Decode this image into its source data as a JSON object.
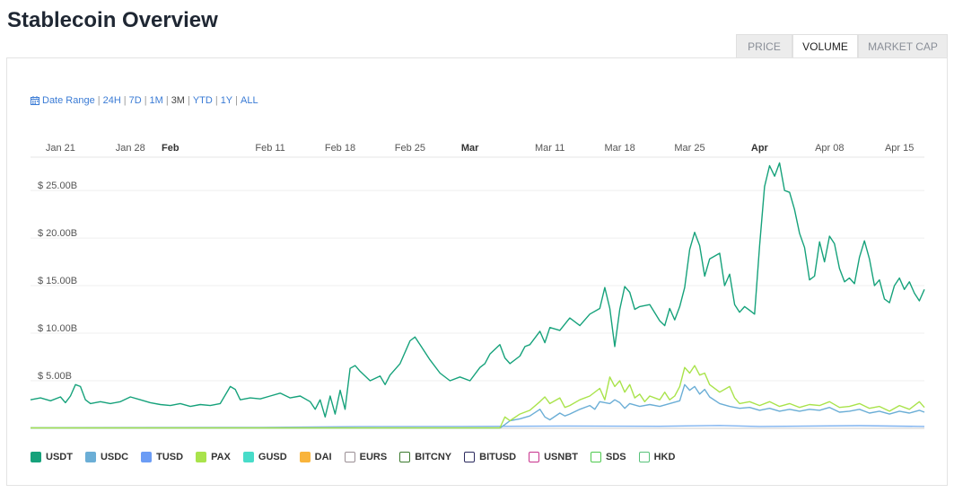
{
  "page": {
    "title": "Stablecoin Overview"
  },
  "tabs": [
    {
      "label": "PRICE",
      "active": false
    },
    {
      "label": "VOLUME",
      "active": true
    },
    {
      "label": "MARKET CAP",
      "active": false
    }
  ],
  "range": {
    "label": "Date Range",
    "options": [
      {
        "label": "24H",
        "active": false
      },
      {
        "label": "7D",
        "active": false
      },
      {
        "label": "1M",
        "active": false
      },
      {
        "label": "3M",
        "active": true
      },
      {
        "label": "YTD",
        "active": false
      },
      {
        "label": "1Y",
        "active": false
      },
      {
        "label": "ALL",
        "active": false
      }
    ]
  },
  "chart_data": {
    "type": "line",
    "x_ticks": [
      {
        "label": "Jan 21",
        "day": 0,
        "bold": false
      },
      {
        "label": "Jan 28",
        "day": 7,
        "bold": false
      },
      {
        "label": "Feb",
        "day": 11,
        "bold": true
      },
      {
        "label": "Feb 11",
        "day": 21,
        "bold": false
      },
      {
        "label": "Feb 18",
        "day": 28,
        "bold": false
      },
      {
        "label": "Feb 25",
        "day": 35,
        "bold": false
      },
      {
        "label": "Mar",
        "day": 41,
        "bold": true
      },
      {
        "label": "Mar 11",
        "day": 49,
        "bold": false
      },
      {
        "label": "Mar 18",
        "day": 56,
        "bold": false
      },
      {
        "label": "Mar 25",
        "day": 63,
        "bold": false
      },
      {
        "label": "Apr",
        "day": 70,
        "bold": true
      },
      {
        "label": "Apr 08",
        "day": 77,
        "bold": false
      },
      {
        "label": "Apr 15",
        "day": 84,
        "bold": false
      }
    ],
    "xlim": [
      -3,
      86.5
    ],
    "y_ticks": [
      {
        "label": "$ 5.00B",
        "value": 5
      },
      {
        "label": "$ 10.00B",
        "value": 10
      },
      {
        "label": "$ 15.00B",
        "value": 15
      },
      {
        "label": "$ 20.00B",
        "value": 20
      },
      {
        "label": "$ 25.00B",
        "value": 25
      }
    ],
    "ylim": [
      0,
      28.5
    ],
    "grid": true,
    "series": [
      {
        "name": "USDT",
        "color": "#16a27b",
        "points": [
          [
            -3,
            3.0
          ],
          [
            -2,
            3.2
          ],
          [
            -1,
            2.9
          ],
          [
            0,
            3.3
          ],
          [
            0.5,
            2.7
          ],
          [
            1,
            3.4
          ],
          [
            1.5,
            4.6
          ],
          [
            2,
            4.4
          ],
          [
            2.5,
            3.0
          ],
          [
            3,
            2.6
          ],
          [
            4,
            2.8
          ],
          [
            5,
            2.6
          ],
          [
            6,
            2.8
          ],
          [
            7,
            3.3
          ],
          [
            8,
            3.0
          ],
          [
            9,
            2.7
          ],
          [
            10,
            2.5
          ],
          [
            11,
            2.4
          ],
          [
            12,
            2.6
          ],
          [
            13,
            2.3
          ],
          [
            14,
            2.5
          ],
          [
            15,
            2.4
          ],
          [
            16,
            2.6
          ],
          [
            17,
            4.4
          ],
          [
            17.5,
            4.1
          ],
          [
            18,
            3.0
          ],
          [
            19,
            3.2
          ],
          [
            20,
            3.1
          ],
          [
            21,
            3.4
          ],
          [
            22,
            3.7
          ],
          [
            23,
            3.2
          ],
          [
            24,
            3.4
          ],
          [
            25,
            2.8
          ],
          [
            25.5,
            2.0
          ],
          [
            26,
            3.0
          ],
          [
            26.5,
            1.2
          ],
          [
            27,
            3.4
          ],
          [
            27.5,
            1.5
          ],
          [
            28,
            4.0
          ],
          [
            28.5,
            2.0
          ],
          [
            29,
            6.3
          ],
          [
            29.5,
            6.6
          ],
          [
            30,
            6.0
          ],
          [
            31,
            5.0
          ],
          [
            32,
            5.5
          ],
          [
            32.5,
            4.6
          ],
          [
            33,
            5.6
          ],
          [
            34,
            6.8
          ],
          [
            35,
            9.2
          ],
          [
            35.5,
            9.6
          ],
          [
            36,
            8.8
          ],
          [
            37,
            7.2
          ],
          [
            38,
            5.8
          ],
          [
            39,
            5.0
          ],
          [
            40,
            5.4
          ],
          [
            41,
            5.0
          ],
          [
            42,
            6.4
          ],
          [
            42.5,
            6.8
          ],
          [
            43,
            7.8
          ],
          [
            44,
            8.8
          ],
          [
            44.5,
            7.4
          ],
          [
            45,
            6.8
          ],
          [
            46,
            7.6
          ],
          [
            46.5,
            8.6
          ],
          [
            47,
            8.8
          ],
          [
            48,
            10.2
          ],
          [
            48.5,
            9.0
          ],
          [
            49,
            10.6
          ],
          [
            50,
            10.3
          ],
          [
            51,
            11.6
          ],
          [
            52,
            10.8
          ],
          [
            53,
            12.0
          ],
          [
            54,
            12.6
          ],
          [
            54.5,
            14.8
          ],
          [
            55,
            12.6
          ],
          [
            55.5,
            8.6
          ],
          [
            56,
            12.5
          ],
          [
            56.5,
            14.9
          ],
          [
            57,
            14.3
          ],
          [
            57.5,
            12.5
          ],
          [
            58,
            12.8
          ],
          [
            59,
            13.0
          ],
          [
            60,
            11.3
          ],
          [
            60.5,
            10.8
          ],
          [
            61,
            12.6
          ],
          [
            61.5,
            11.4
          ],
          [
            62,
            12.8
          ],
          [
            62.5,
            14.8
          ],
          [
            63,
            18.8
          ],
          [
            63.5,
            20.6
          ],
          [
            64,
            19.2
          ],
          [
            64.5,
            16.0
          ],
          [
            65,
            17.8
          ],
          [
            66,
            18.4
          ],
          [
            66.5,
            15.0
          ],
          [
            67,
            16.2
          ],
          [
            67.5,
            13.0
          ],
          [
            68,
            12.2
          ],
          [
            68.5,
            12.8
          ],
          [
            69,
            12.4
          ],
          [
            69.5,
            12.0
          ],
          [
            70,
            19.2
          ],
          [
            70.5,
            25.4
          ],
          [
            71,
            27.6
          ],
          [
            71.5,
            26.5
          ],
          [
            72,
            27.9
          ],
          [
            72.5,
            25.0
          ],
          [
            73,
            24.8
          ],
          [
            73.5,
            23.0
          ],
          [
            74,
            20.5
          ],
          [
            74.5,
            19.0
          ],
          [
            75,
            15.6
          ],
          [
            75.5,
            16.0
          ],
          [
            76,
            19.6
          ],
          [
            76.5,
            17.5
          ],
          [
            77,
            20.2
          ],
          [
            77.5,
            19.4
          ],
          [
            78,
            16.8
          ],
          [
            78.5,
            15.4
          ],
          [
            79,
            15.8
          ],
          [
            79.5,
            15.2
          ],
          [
            80,
            18.0
          ],
          [
            80.5,
            19.7
          ],
          [
            81,
            17.8
          ],
          [
            81.5,
            15.0
          ],
          [
            82,
            15.6
          ],
          [
            82.5,
            13.6
          ],
          [
            83,
            13.2
          ],
          [
            83.5,
            15.0
          ],
          [
            84,
            15.8
          ],
          [
            84.5,
            14.6
          ],
          [
            85,
            15.4
          ],
          [
            85.5,
            14.2
          ],
          [
            86,
            13.4
          ],
          [
            86.5,
            14.6
          ]
        ]
      },
      {
        "name": "PAX",
        "color": "#a9e34b",
        "points": [
          [
            -3,
            0.05
          ],
          [
            44,
            0.05
          ],
          [
            44.5,
            1.2
          ],
          [
            45,
            0.8
          ],
          [
            46,
            1.5
          ],
          [
            47,
            1.9
          ],
          [
            48,
            2.8
          ],
          [
            48.5,
            3.3
          ],
          [
            49,
            2.6
          ],
          [
            50,
            3.2
          ],
          [
            50.5,
            2.2
          ],
          [
            51,
            2.4
          ],
          [
            52,
            3.0
          ],
          [
            53,
            3.4
          ],
          [
            54,
            4.2
          ],
          [
            54.5,
            3.0
          ],
          [
            55,
            5.4
          ],
          [
            55.5,
            4.4
          ],
          [
            56,
            5.0
          ],
          [
            56.5,
            3.8
          ],
          [
            57,
            4.6
          ],
          [
            57.5,
            3.2
          ],
          [
            58,
            3.6
          ],
          [
            58.5,
            2.8
          ],
          [
            59,
            3.4
          ],
          [
            60,
            3.0
          ],
          [
            60.5,
            3.8
          ],
          [
            61,
            3.0
          ],
          [
            61.5,
            3.4
          ],
          [
            62,
            4.4
          ],
          [
            62.5,
            6.4
          ],
          [
            63,
            5.8
          ],
          [
            63.5,
            6.6
          ],
          [
            64,
            5.6
          ],
          [
            64.5,
            5.8
          ],
          [
            65,
            4.6
          ],
          [
            66,
            3.8
          ],
          [
            67,
            4.4
          ],
          [
            67.5,
            3.2
          ],
          [
            68,
            2.6
          ],
          [
            69,
            2.8
          ],
          [
            70,
            2.4
          ],
          [
            71,
            2.8
          ],
          [
            72,
            2.3
          ],
          [
            73,
            2.6
          ],
          [
            74,
            2.2
          ],
          [
            75,
            2.5
          ],
          [
            76,
            2.4
          ],
          [
            77,
            2.8
          ],
          [
            78,
            2.2
          ],
          [
            79,
            2.3
          ],
          [
            80,
            2.6
          ],
          [
            81,
            2.1
          ],
          [
            82,
            2.3
          ],
          [
            83,
            1.8
          ],
          [
            84,
            2.4
          ],
          [
            85,
            2.0
          ],
          [
            86,
            2.8
          ],
          [
            86.5,
            2.2
          ]
        ]
      },
      {
        "name": "USDC",
        "color": "#6baed6",
        "points": [
          [
            -3,
            0.03
          ],
          [
            44,
            0.03
          ],
          [
            44.5,
            0.4
          ],
          [
            45,
            0.8
          ],
          [
            46,
            1.0
          ],
          [
            47,
            1.3
          ],
          [
            48,
            2.0
          ],
          [
            48.5,
            1.2
          ],
          [
            49,
            0.9
          ],
          [
            50,
            1.6
          ],
          [
            50.5,
            1.3
          ],
          [
            51,
            1.5
          ],
          [
            52,
            2.0
          ],
          [
            53,
            2.4
          ],
          [
            53.5,
            2.0
          ],
          [
            54,
            2.8
          ],
          [
            55,
            2.6
          ],
          [
            55.5,
            3.0
          ],
          [
            56,
            2.7
          ],
          [
            56.5,
            2.1
          ],
          [
            57,
            2.6
          ],
          [
            58,
            2.3
          ],
          [
            59,
            2.5
          ],
          [
            60,
            2.3
          ],
          [
            61,
            2.6
          ],
          [
            62,
            2.9
          ],
          [
            62.5,
            4.6
          ],
          [
            63,
            4.0
          ],
          [
            63.5,
            4.4
          ],
          [
            64,
            3.6
          ],
          [
            64.5,
            4.1
          ],
          [
            65,
            3.3
          ],
          [
            66,
            2.6
          ],
          [
            67,
            2.3
          ],
          [
            68,
            2.1
          ],
          [
            69,
            2.2
          ],
          [
            70,
            1.9
          ],
          [
            71,
            2.1
          ],
          [
            72,
            1.8
          ],
          [
            73,
            2.0
          ],
          [
            74,
            1.8
          ],
          [
            75,
            2.0
          ],
          [
            76,
            1.9
          ],
          [
            77,
            2.2
          ],
          [
            78,
            1.7
          ],
          [
            79,
            1.8
          ],
          [
            80,
            2.0
          ],
          [
            81,
            1.6
          ],
          [
            82,
            1.8
          ],
          [
            83,
            1.5
          ],
          [
            84,
            1.8
          ],
          [
            85,
            1.6
          ],
          [
            86,
            1.9
          ],
          [
            86.5,
            1.7
          ]
        ]
      },
      {
        "name": "TUSD",
        "color": "#7fb3f0",
        "points": [
          [
            -3,
            0.08
          ],
          [
            20,
            0.1
          ],
          [
            30,
            0.18
          ],
          [
            40,
            0.2
          ],
          [
            50,
            0.25
          ],
          [
            60,
            0.22
          ],
          [
            66,
            0.3
          ],
          [
            70,
            0.2
          ],
          [
            80,
            0.28
          ],
          [
            86.5,
            0.2
          ]
        ]
      }
    ]
  },
  "legend": [
    {
      "label": "USDT",
      "color": "#16a27b",
      "filled": true
    },
    {
      "label": "USDC",
      "color": "#6baed6",
      "filled": true
    },
    {
      "label": "TUSD",
      "color": "#6b9cf5",
      "filled": true
    },
    {
      "label": "PAX",
      "color": "#a9e34b",
      "filled": true
    },
    {
      "label": "GUSD",
      "color": "#48dcc9",
      "filled": true
    },
    {
      "label": "DAI",
      "color": "#f9b43b",
      "filled": true
    },
    {
      "label": "EURS",
      "color": "#9b8f95",
      "filled": false
    },
    {
      "label": "BITCNY",
      "color": "#3c7a2e",
      "filled": false
    },
    {
      "label": "BITUSD",
      "color": "#2b2a5e",
      "filled": false
    },
    {
      "label": "USNBT",
      "color": "#c8338d",
      "filled": false
    },
    {
      "label": "SDS",
      "color": "#4ec94e",
      "filled": false
    },
    {
      "label": "HKD",
      "color": "#58c27a",
      "filled": false
    }
  ]
}
